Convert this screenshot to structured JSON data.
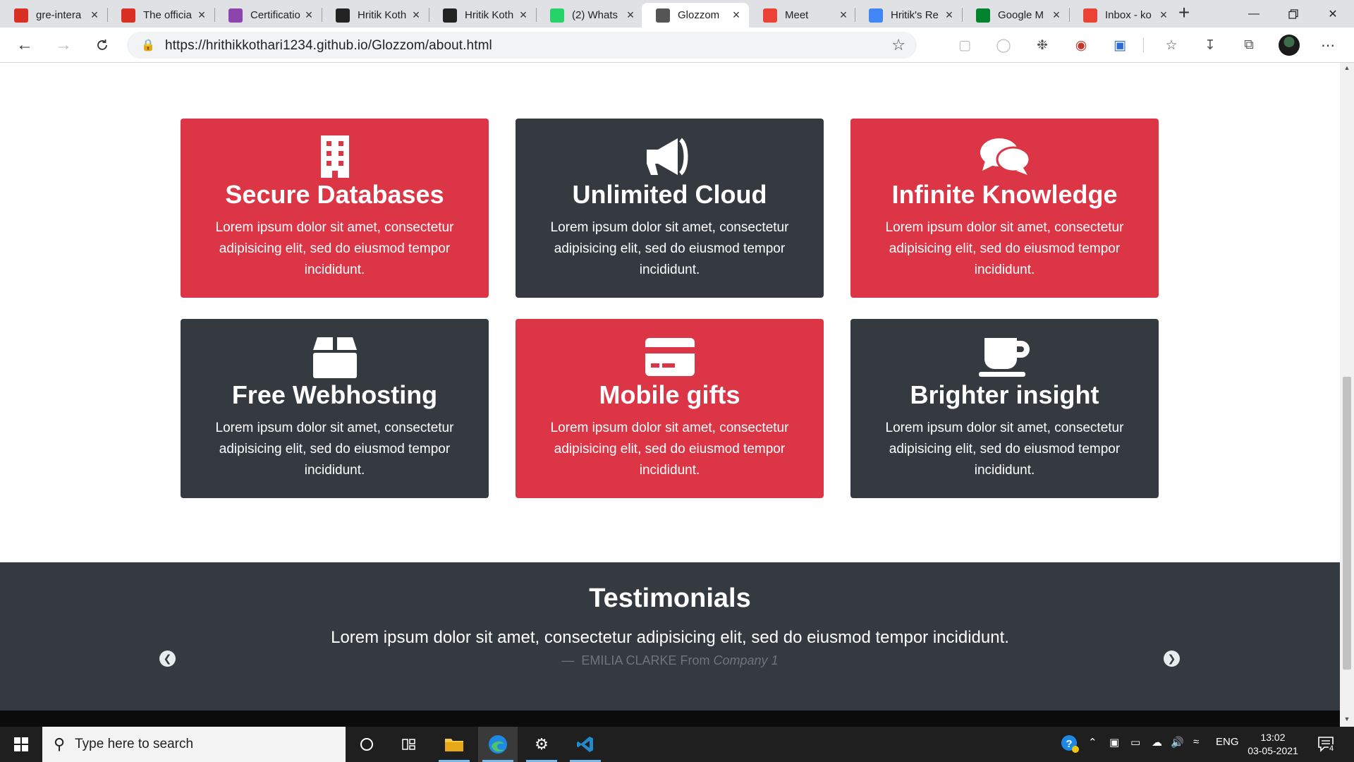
{
  "browser": {
    "tabs": [
      {
        "title": "gre-intera",
        "icon": "pdf-icon",
        "color": "#d93025"
      },
      {
        "title": "The officia",
        "icon": "pdf-icon",
        "color": "#d93025"
      },
      {
        "title": "Certificatio",
        "icon": "certificate-icon",
        "color": "#8e44ad"
      },
      {
        "title": "Hritik Koth",
        "icon": "profile-icon",
        "color": "#222222"
      },
      {
        "title": "Hritik Koth",
        "icon": "profile-icon",
        "color": "#222222"
      },
      {
        "title": "(2) Whats",
        "icon": "whatsapp-icon",
        "color": "#25d366"
      },
      {
        "title": "Glozzom",
        "icon": "page-icon",
        "color": "#555555",
        "active": true
      },
      {
        "title": "Meet",
        "icon": "meet-icon",
        "color": "#ea4335"
      },
      {
        "title": "Hritik's Re",
        "icon": "docs-icon",
        "color": "#4285f4"
      },
      {
        "title": "Google M",
        "icon": "meet-icon",
        "color": "#00832d"
      },
      {
        "title": "Inbox - ko",
        "icon": "gmail-icon",
        "color": "#ea4335"
      }
    ],
    "url": "https://hrithikkothari1234.github.io/Glozzom/about.html"
  },
  "page": {
    "cards": [
      {
        "title": "Secure Databases",
        "text": "Lorem ipsum dolor sit amet, consectetur adipisicing elit, sed do eiusmod tempor incididunt.",
        "icon": "building-icon",
        "theme": "red"
      },
      {
        "title": "Unlimited Cloud",
        "text": "Lorem ipsum dolor sit amet, consectetur adipisicing elit, sed do eiusmod tempor incididunt.",
        "icon": "bullhorn-icon",
        "theme": "dark"
      },
      {
        "title": "Infinite Knowledge",
        "text": "Lorem ipsum dolor sit amet, consectetur adipisicing elit, sed do eiusmod tempor incididunt.",
        "icon": "comments-icon",
        "theme": "red"
      },
      {
        "title": "Free Webhosting",
        "text": "Lorem ipsum dolor sit amet, consectetur adipisicing elit, sed do eiusmod tempor incididunt.",
        "icon": "box-icon",
        "theme": "dark"
      },
      {
        "title": "Mobile gifts",
        "text": "Lorem ipsum dolor sit amet, consectetur adipisicing elit, sed do eiusmod tempor incididunt.",
        "icon": "credit-card-icon",
        "theme": "red"
      },
      {
        "title": "Brighter insight",
        "text": "Lorem ipsum dolor sit amet, consectetur adipisicing elit, sed do eiusmod tempor incididunt.",
        "icon": "coffee-icon",
        "theme": "dark"
      }
    ],
    "testimonials": {
      "heading": "Testimonials",
      "quote": "Lorem ipsum dolor sit amet, consectetur adipisicing elit, sed do eiusmod tempor incididunt.",
      "dash": "—",
      "author": "EMILIA CLARKE",
      "from": "From",
      "company": "Company 1"
    },
    "colors": {
      "red": "#dc3545",
      "dark": "#343a40"
    }
  },
  "taskbar": {
    "search_placeholder": "Type here to search",
    "language": "ENG",
    "time": "13:02",
    "date": "03-05-2021",
    "notification_count": "4"
  }
}
